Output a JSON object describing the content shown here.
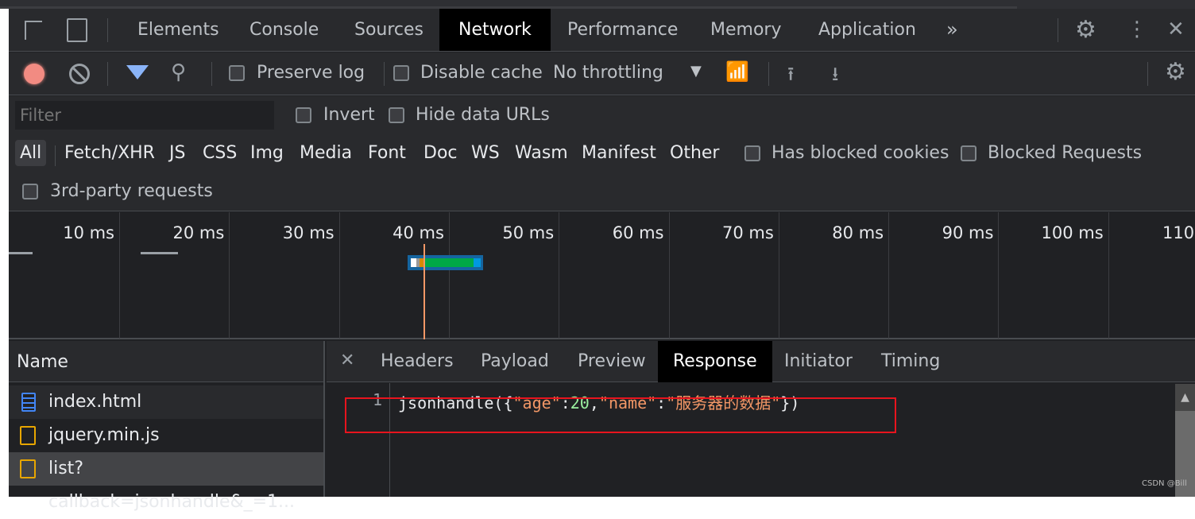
{
  "tabs": [
    "Elements",
    "Console",
    "Sources",
    "Network",
    "Performance",
    "Memory",
    "Application"
  ],
  "active_tab": "Network",
  "toolbar": {
    "preserve_log": "Preserve log",
    "disable_cache": "Disable cache",
    "throttling": "No throttling"
  },
  "filter": {
    "placeholder": "Filter",
    "invert": "Invert",
    "hide_data_urls": "Hide data URLs",
    "types": [
      "All",
      "Fetch/XHR",
      "JS",
      "CSS",
      "Img",
      "Media",
      "Font",
      "Doc",
      "WS",
      "Wasm",
      "Manifest",
      "Other"
    ],
    "has_blocked_cookies": "Has blocked cookies",
    "blocked_requests": "Blocked Requests",
    "third_party": "3rd-party requests"
  },
  "timeline": {
    "ticks": [
      "10 ms",
      "20 ms",
      "30 ms",
      "40 ms",
      "50 ms",
      "60 ms",
      "70 ms",
      "80 ms",
      "90 ms",
      "100 ms",
      "110 ms"
    ]
  },
  "requests": {
    "header": "Name",
    "items": [
      "index.html",
      "jquery.min.js",
      "list?callback=jsonhandle&_=1..."
    ]
  },
  "detail_tabs": [
    "Headers",
    "Payload",
    "Preview",
    "Response",
    "Initiator",
    "Timing"
  ],
  "active_detail": "Response",
  "response": {
    "line": "1",
    "fn": "jsonhandle({",
    "k1": "\"age\"",
    "c1": ":",
    "v1": "20",
    "comma": ",",
    "k2": "\"name\"",
    "c2": ":",
    "v2": "\"服务器的数据\"",
    "end": "})"
  },
  "watermark": "CSDN @Bill",
  "colors": {
    "record": "#f28b82",
    "accent": "#8ab4f8",
    "string": "#f29766",
    "number": "#9bf0a0",
    "highlight": "#e8141e"
  }
}
